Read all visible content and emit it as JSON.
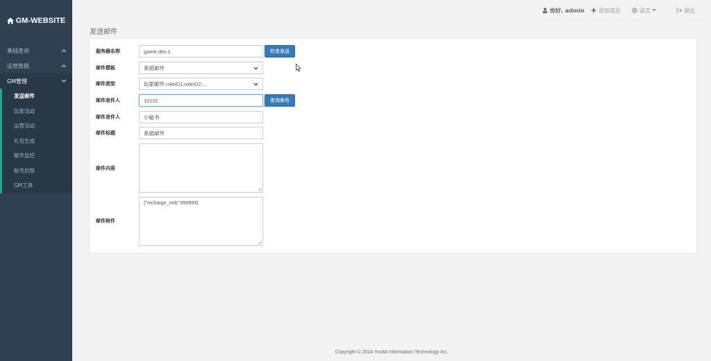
{
  "brand": {
    "title": "GM-WEBSITE",
    "icon": "home-icon"
  },
  "sidebar": {
    "groups": [
      {
        "label": "基础查询",
        "icon": "chevron-up-icon"
      },
      {
        "label": "运营数据",
        "icon": "chevron-up-icon"
      },
      {
        "label": "GM管理",
        "icon": "chevron-down-icon"
      }
    ],
    "sub_items": [
      {
        "label": "发送邮件"
      },
      {
        "label": "玩家活动"
      },
      {
        "label": "运营活动"
      },
      {
        "label": "礼包生成"
      },
      {
        "label": "聊天监控"
      },
      {
        "label": "账号封禁"
      },
      {
        "label": "GM工具"
      }
    ]
  },
  "topbar": {
    "user_label": "你好, admin",
    "add_member": "添加成员",
    "language": "语言",
    "logout": "退出"
  },
  "page": {
    "title": "发送邮件"
  },
  "form": {
    "server": {
      "label": "服务器名称",
      "value": "game.dev.1",
      "button": "检查发送"
    },
    "template": {
      "label": "邮件模板",
      "value": "系统邮件"
    },
    "type": {
      "label": "邮件类型",
      "value": "玩家邮件:roleID1;roleID2;..."
    },
    "recipient": {
      "label": "邮件收件人",
      "value": "10102",
      "button": "查询角色"
    },
    "sender": {
      "label": "邮件发件人",
      "value": "小秘书"
    },
    "subject": {
      "label": "邮件标题",
      "value": "系统邮件"
    },
    "content": {
      "label": "邮件内容",
      "value": ""
    },
    "attachment": {
      "label": "邮件附件",
      "value": "{\"recharge_rmb\":999999}"
    }
  },
  "footer": {
    "copyright": "Copyright © 2014 YouMi Information Technology Inc."
  },
  "colors": {
    "sidebar": "#2f4050",
    "accent": "#19aa8d",
    "primary_button": "#337ab7"
  }
}
